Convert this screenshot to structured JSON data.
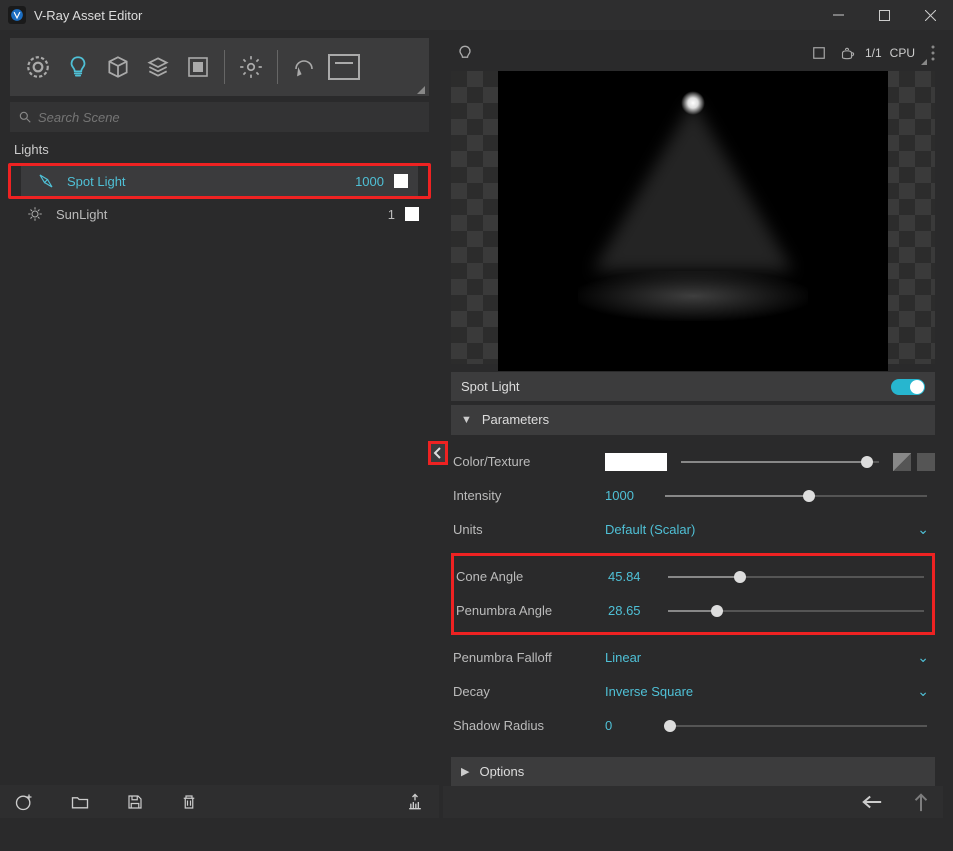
{
  "window": {
    "title": "V-Ray Asset Editor"
  },
  "search": {
    "placeholder": "Search Scene"
  },
  "left": {
    "section_label": "Lights",
    "assets": [
      {
        "label": "Spot Light",
        "value": "1000",
        "selected": true
      },
      {
        "label": "SunLight",
        "value": "1",
        "selected": false
      }
    ]
  },
  "preview_header": {
    "ratio": "1/1",
    "mode": "CPU"
  },
  "properties": {
    "title": "Spot Light",
    "enabled": true,
    "section_parameters": "Parameters",
    "section_options": "Options",
    "params": {
      "color_label": "Color/Texture",
      "intensity_label": "Intensity",
      "intensity_value": "1000",
      "units_label": "Units",
      "units_value": "Default (Scalar)",
      "cone_label": "Cone Angle",
      "cone_value": "45.84",
      "penumbra_label": "Penumbra Angle",
      "penumbra_value": "28.65",
      "falloff_label": "Penumbra Falloff",
      "falloff_value": "Linear",
      "decay_label": "Decay",
      "decay_value": "Inverse Square",
      "shadow_label": "Shadow Radius",
      "shadow_value": "0"
    }
  }
}
